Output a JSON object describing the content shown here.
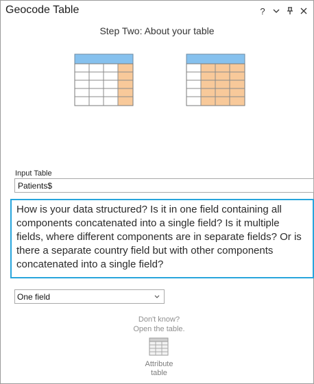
{
  "window": {
    "title": "Geocode Table",
    "help_glyph": "?",
    "options_glyph": "⌄",
    "pin_glyph": "⩒",
    "close_glyph": "✕"
  },
  "step": {
    "title": "Step Two: About your table"
  },
  "graphics": {
    "left_table": "single-field-table-icon",
    "right_table": "multiple-fields-table-icon",
    "header_color": "#86c1ee",
    "highlight_color": "#f8c99a"
  },
  "input_table": {
    "label": "Input Table",
    "value": "Patients$"
  },
  "help_text": "How is your data structured? Is it in one field containing all components concatenated into a single field? Is it multiple fields, where different components are in separate fields? Or is there a separate country field but with other components concatenated into a single field?",
  "structure_select": {
    "selected": "One field",
    "chevron": "⌄"
  },
  "dont_know": {
    "line1": "Don't know?",
    "line2": "Open the table."
  },
  "attribute_table": {
    "line1": "Attribute",
    "line2": "table"
  },
  "colors": {
    "accent": "#27a5dc"
  }
}
